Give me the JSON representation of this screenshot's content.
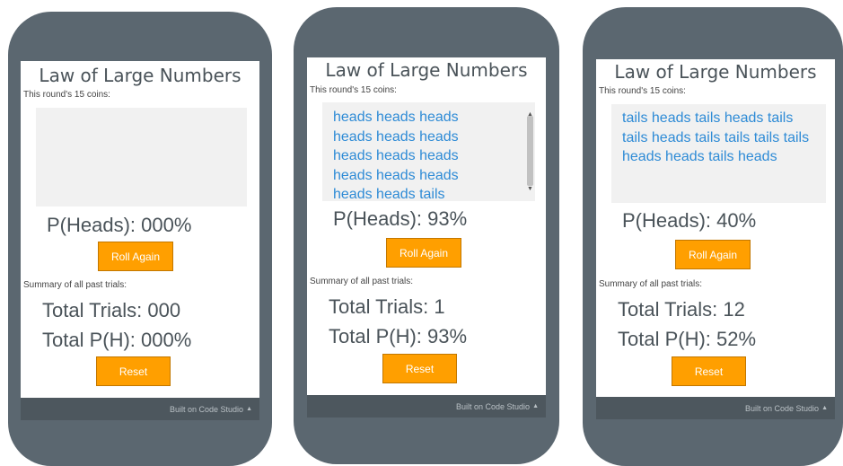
{
  "app": {
    "title": "Law of Large Numbers",
    "coins_label": "This round's 15 coins:",
    "summary_label": "Summary of all past trials:",
    "roll_label": "Roll Again",
    "reset_label": "Reset",
    "footer_label": "Built on Code Studio",
    "footer_caret": "▲"
  },
  "colors": {
    "phone_frame": "#5b6770",
    "button": "#ff9f00",
    "coin_text": "#2e8bd6",
    "footer": "#4d575e"
  },
  "phones": [
    {
      "coins_text": "",
      "p_heads": "P(Heads): 000%",
      "total_trials": "Total Trials: 000",
      "total_ph": "Total P(H): 000%"
    },
    {
      "coins_text": "heads heads heads heads heads heads heads heads heads heads heads heads heads heads tails",
      "p_heads": "P(Heads): 93%",
      "total_trials": "Total Trials: 1",
      "total_ph": "Total P(H): 93%"
    },
    {
      "coins_text": "tails heads tails heads tails tails heads tails tails tails tails heads heads tails heads",
      "p_heads": "P(Heads): 40%",
      "total_trials": "Total Trials: 12",
      "total_ph": "Total P(H): 52%"
    }
  ]
}
